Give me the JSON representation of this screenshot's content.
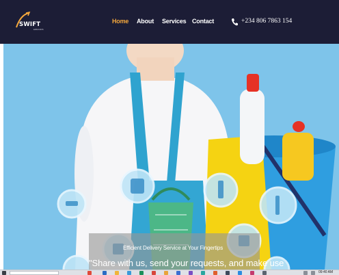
{
  "brand": {
    "name": "SWIFT",
    "subtitle": "ERRANDS"
  },
  "nav": {
    "items": [
      {
        "label": "Home",
        "active": true
      },
      {
        "label": "About",
        "active": false
      },
      {
        "label": "Services",
        "active": false
      },
      {
        "label": "Contact",
        "active": false
      }
    ],
    "phone_icon": "phone-icon",
    "phone": "+234 806 7863 154"
  },
  "hero": {
    "tagline": "Efficient Delivery Service at Your Fingertips",
    "quote": "\"Share with us, send your requests, and make use"
  },
  "taskbar": {
    "clock": "09:40 AM"
  },
  "colors": {
    "navbar_bg": "#1c1d36",
    "accent": "#f4a73c",
    "hero_bg": "#7ec4ea"
  }
}
